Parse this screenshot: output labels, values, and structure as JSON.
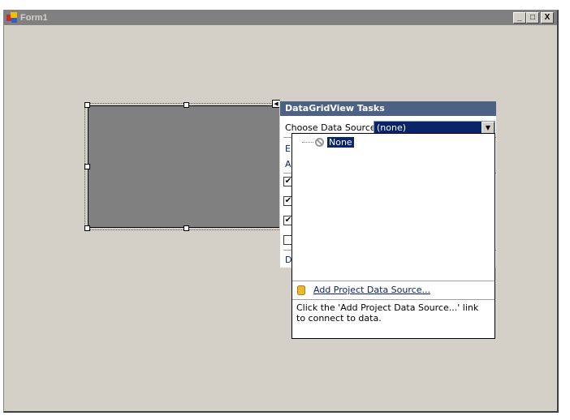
{
  "window": {
    "title": "Form1",
    "buttons": {
      "minimize": "_",
      "maximize": "□",
      "close": "X"
    }
  },
  "tasks_panel": {
    "title": "DataGridView Tasks",
    "choose_label": "Choose Data Source",
    "combo_value": "(none)",
    "hidden_items": [
      {
        "label": "E"
      },
      {
        "label": "A"
      }
    ],
    "checkboxes": [
      {
        "checked": true
      },
      {
        "checked": true
      },
      {
        "checked": true
      },
      {
        "checked": false
      }
    ],
    "dock_item": "D"
  },
  "dropdown": {
    "tree_item": "None",
    "add_link": "Add Project Data Source...",
    "help_text": "Click the 'Add Project Data Source...' link to connect to data."
  },
  "colors": {
    "titlebar": "#808080",
    "panel_header": "#4d6185",
    "selection": "#0a246a",
    "form": "#d4d0c8"
  }
}
